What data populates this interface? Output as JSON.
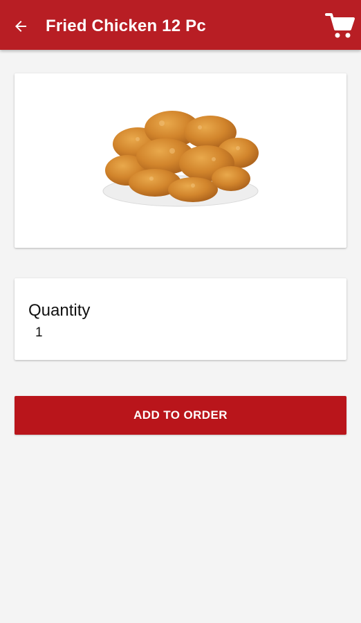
{
  "app_bar": {
    "title": "Fried Chicken 12 Pc",
    "back_icon": "arrow-left-icon",
    "cart_icon": "shopping-cart-icon",
    "background_color": "#b81e24"
  },
  "product": {
    "image": "fried-chicken-plate-image"
  },
  "quantity": {
    "label": "Quantity",
    "value": "1"
  },
  "actions": {
    "add_to_order_label": "ADD TO ORDER",
    "button_color": "#b9151b"
  }
}
